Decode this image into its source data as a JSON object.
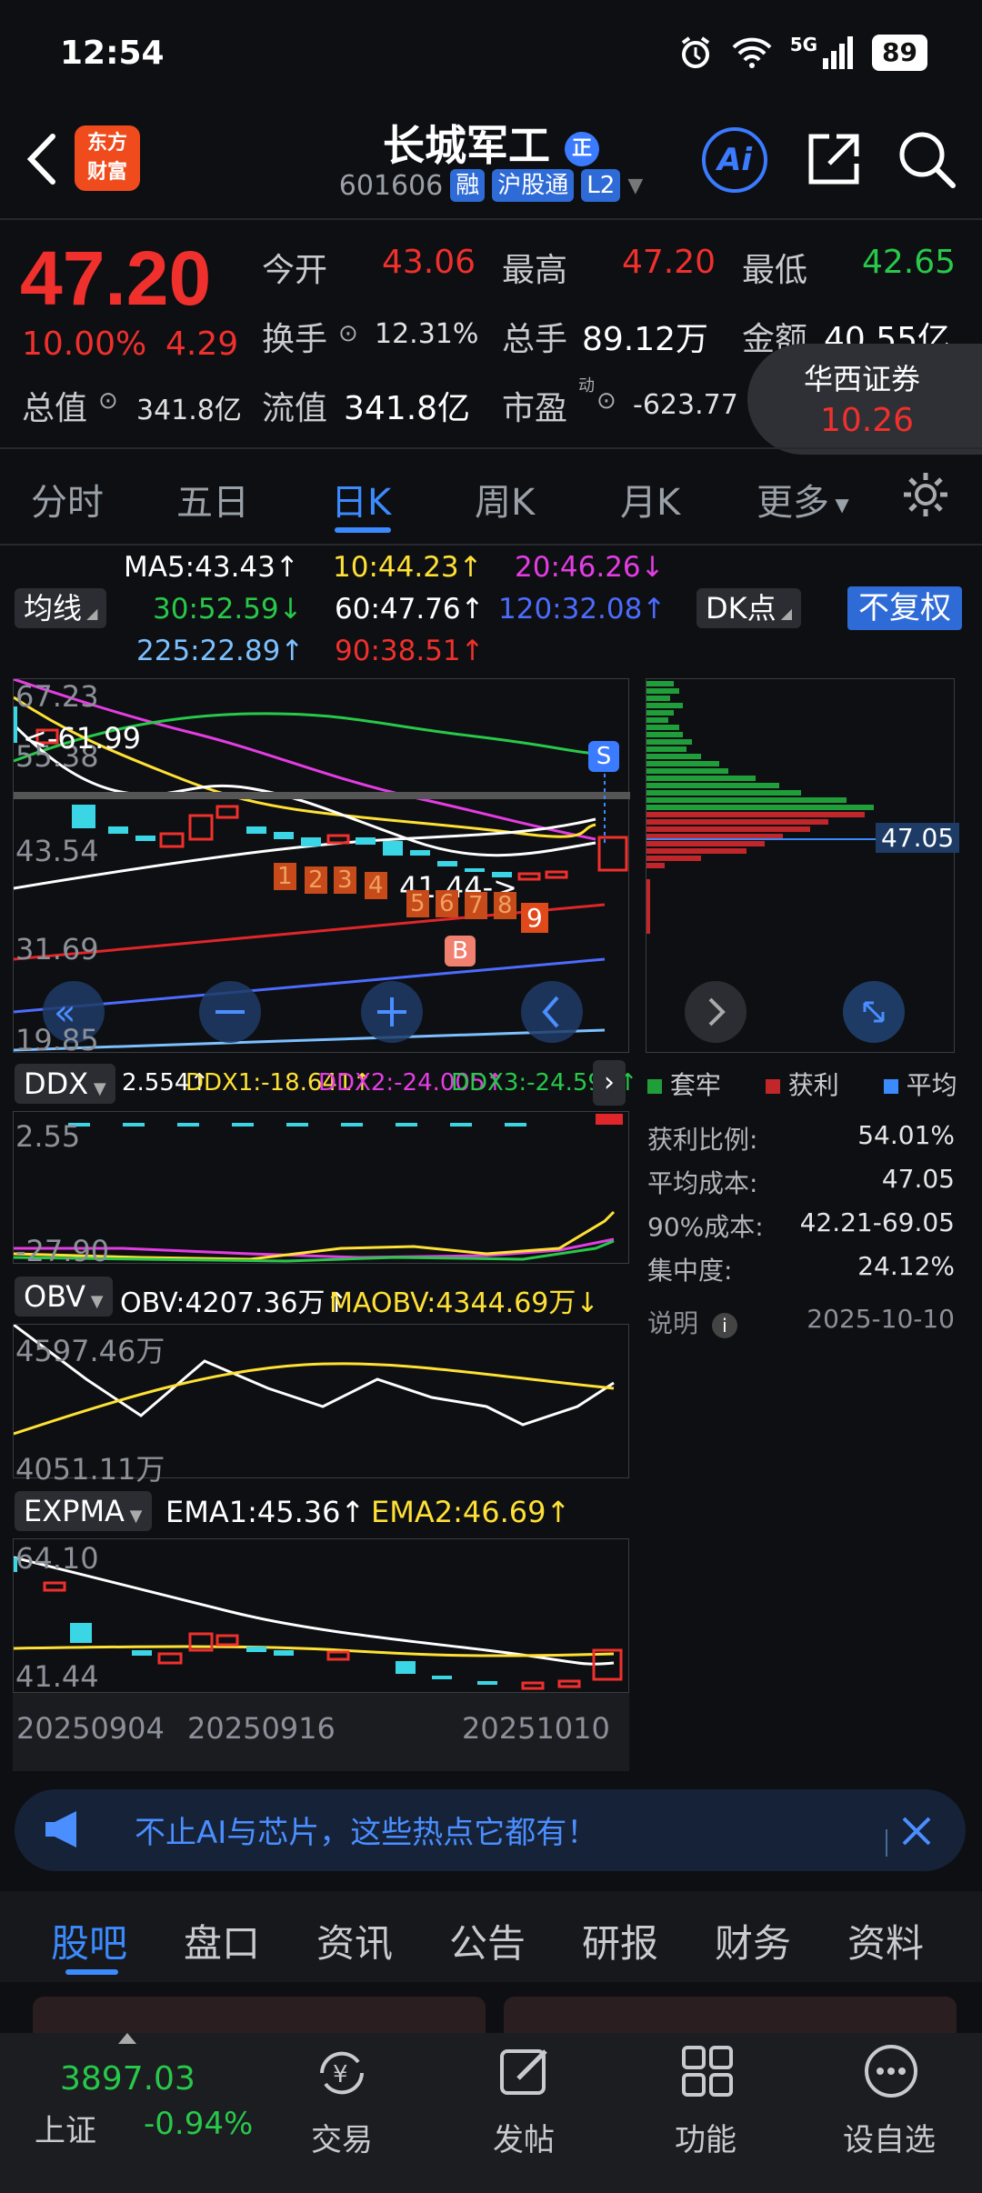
{
  "status": {
    "time": "12:54",
    "network": "5G",
    "battery": "89"
  },
  "header": {
    "logo_line1": "东方",
    "logo_line2": "财富",
    "stock_name": "长城军工",
    "code": "601606",
    "tags": [
      "融",
      "沪股通",
      "L2"
    ],
    "ai_label": "Ai"
  },
  "quote": {
    "price": "47.20",
    "pct": "10.00%",
    "change": "4.29",
    "open_label": "今开",
    "open": "43.06",
    "high_label": "最高",
    "high": "47.20",
    "low_label": "最低",
    "low": "42.65",
    "turnover_label": "换手",
    "turnover": "12.31%",
    "volume_label": "总手",
    "volume": "89.12万",
    "amount_label": "金额",
    "amount": "40.55亿",
    "mktcap_label": "总值",
    "mktcap": "341.8亿",
    "float_label": "流值",
    "float": "341.8亿",
    "pe_label": "市盈",
    "pe_sup": "动",
    "pe": "-623.77"
  },
  "broker": {
    "name": "华西证券",
    "value": "10.26"
  },
  "ktabs": [
    "分时",
    "五日",
    "日K",
    "周K",
    "月K",
    "更多"
  ],
  "active_ktab": "日K",
  "ma_legend": {
    "select": "均线",
    "ma5": "MA5:43.43↑",
    "ma10": "10:44.23↑",
    "ma20": "20:46.26↓",
    "ma30": "30:52.59↓",
    "ma60": "60:47.76↑",
    "ma120": "120:32.08↑",
    "ma225": "225:22.89↑",
    "ma90": "90:38.51↑",
    "dk_select": "DK点",
    "fq_btn": "不复权"
  },
  "main_chart": {
    "y_labels": [
      "67.23",
      "55.38",
      "43.54",
      "31.69",
      "19.85"
    ],
    "price_tag": "<-61.99",
    "price_tag2": "41.44->",
    "nine_counts": [
      "1",
      "2",
      "3",
      "4",
      "5",
      "6",
      "7",
      "8",
      "9"
    ],
    "signal_s": "S",
    "signal_b": "B",
    "chip_price": "47.05"
  },
  "chip_legend": {
    "trapped": "套牢",
    "profit": "获利",
    "average": "平均"
  },
  "chip_stats": [
    {
      "label": "获利比例:",
      "value": "54.01%"
    },
    {
      "label": "平均成本:",
      "value": "47.05"
    },
    {
      "label": "90%成本:",
      "value": "42.21-69.05"
    },
    {
      "label": "集中度:",
      "value": "24.12%"
    }
  ],
  "chip_note": {
    "label": "说明",
    "date": "2025-10-10"
  },
  "ddx": {
    "select": "DDX",
    "v": "2.554↑",
    "ddx1": "DDX1:-18.641↑",
    "ddx2": "DDX2:-24.005↑",
    "ddx3": "DDX3:-24.598↑",
    "top": "2.55",
    "bottom": "-27.90"
  },
  "obv": {
    "select": "OBV",
    "obv": "OBV:4207.36万↑",
    "maobv": "MAOBV:4344.69万↓",
    "top": "4597.46万",
    "bottom": "4051.11万"
  },
  "expma": {
    "select": "EXPMA",
    "ema1": "EMA1:45.36↑",
    "ema2": "EMA2:46.69↑",
    "top": "64.10",
    "bottom": "41.44"
  },
  "dates": [
    "20250904",
    "20250916",
    "20251010"
  ],
  "banner": {
    "text": "不止AI与芯片，这些热点它都有！"
  },
  "bottom_tabs": [
    "股吧",
    "盘口",
    "资讯",
    "公告",
    "研报",
    "财务",
    "资料"
  ],
  "active_bottom_tab": "股吧",
  "index": {
    "value": "3897.03",
    "name": "上证",
    "pct": "-0.94%"
  },
  "nav": [
    "交易",
    "发帖",
    "功能",
    "设自选"
  ],
  "colors": {
    "up": "#f0302c",
    "down": "#28c84a",
    "accent": "#3b8bff"
  }
}
